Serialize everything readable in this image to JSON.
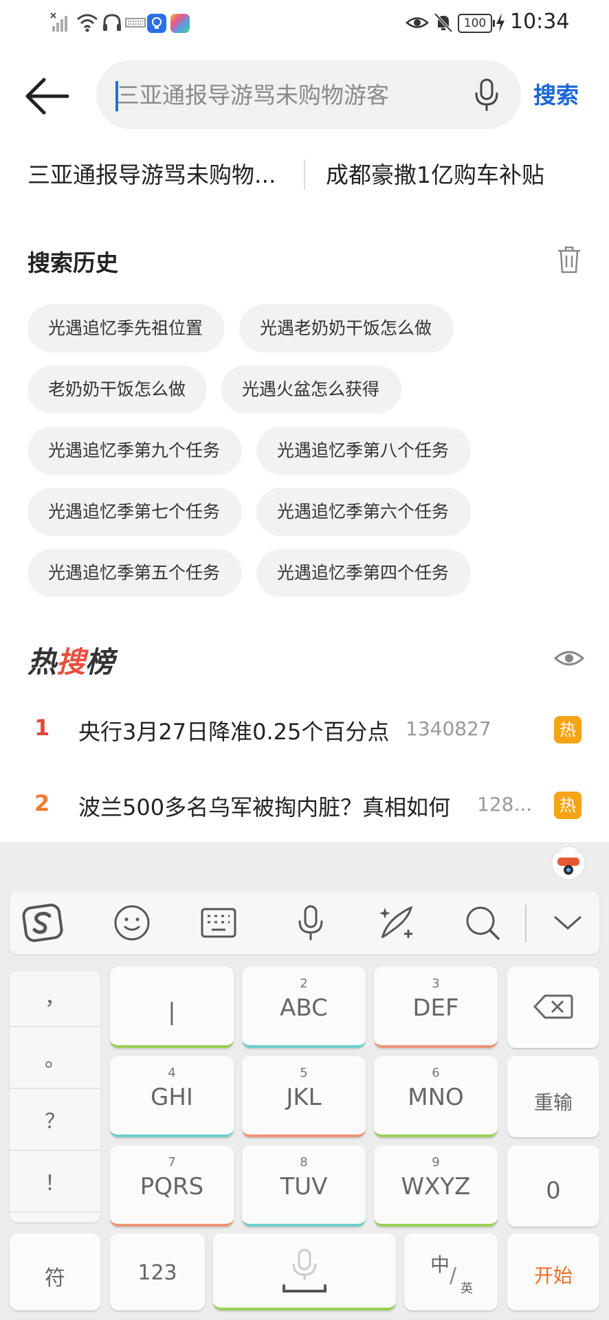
{
  "status_bar": {
    "time": "10:34",
    "battery": "100",
    "icons": [
      "no-signal-icon",
      "wifi-icon",
      "headphones-icon",
      "keyboard-icon",
      "bulb-app-icon",
      "app-icon",
      "eye-icon",
      "mute-icon",
      "charging-icon"
    ]
  },
  "search": {
    "placeholder": "三亚通报导游骂未购物游客",
    "button_label": "搜索"
  },
  "suggestions": [
    "三亚通报导游骂未购物...",
    "成都豪撒1亿购车补贴"
  ],
  "history": {
    "title": "搜索历史",
    "items": [
      "光遇追忆季先祖位置",
      "光遇老奶奶干饭怎么做",
      "老奶奶干饭怎么做",
      "光遇火盆怎么获得",
      "光遇追忆季第九个任务",
      "光遇追忆季第八个任务",
      "光遇追忆季第七个任务",
      "光遇追忆季第六个任务",
      "光遇追忆季第五个任务",
      "光遇追忆季第四个任务"
    ]
  },
  "hot_board": {
    "title_part1": "热",
    "title_part2": "搜",
    "title_part3": "榜",
    "items": [
      {
        "rank": "1",
        "text": "央行3月27日降准0.25个百分点",
        "count": "1340827",
        "badge": "热",
        "rank_color": "#e0473a"
      },
      {
        "rank": "2",
        "text": "波兰500多名乌军被掏内脏？真相如何",
        "count": "128...",
        "badge": "热",
        "rank_color": "#ef7b2c"
      }
    ]
  },
  "keyboard": {
    "punctuation": [
      "，",
      "。",
      "？",
      "！"
    ],
    "keys": [
      {
        "num": "",
        "label": "|"
      },
      {
        "num": "2",
        "label": "ABC"
      },
      {
        "num": "3",
        "label": "DEF"
      },
      {
        "num": "4",
        "label": "GHI"
      },
      {
        "num": "5",
        "label": "JKL"
      },
      {
        "num": "6",
        "label": "MNO"
      },
      {
        "num": "7",
        "label": "PQRS"
      },
      {
        "num": "8",
        "label": "TUV"
      },
      {
        "num": "9",
        "label": "WXYZ"
      }
    ],
    "reenter_label": "重输",
    "zero_label": "0",
    "symbol_label": "符",
    "num123_label": "123",
    "lang_label_main": "中",
    "lang_label_sub": "英",
    "start_label": "开始",
    "start_color": "#e8702a"
  }
}
